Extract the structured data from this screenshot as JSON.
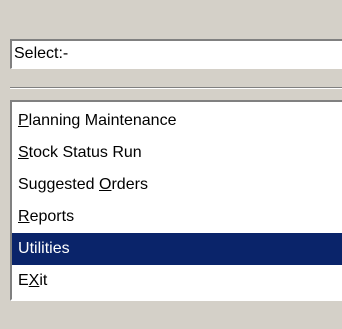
{
  "select": {
    "value": "Select:-"
  },
  "menu": {
    "selected_index": 4,
    "items": [
      {
        "label": "Planning Maintenance",
        "mnemonic_index": 0
      },
      {
        "label": "Stock Status Run",
        "mnemonic_index": 0
      },
      {
        "label": "Suggested Orders",
        "mnemonic_index": 10
      },
      {
        "label": "Reports",
        "mnemonic_index": 0
      },
      {
        "label": "Utilities",
        "mnemonic_index": -1
      },
      {
        "label": "EXit",
        "mnemonic_index": 1
      }
    ]
  },
  "colors": {
    "selection_background": "#0a246a",
    "selection_text": "#ffffff",
    "window_background": "#d4d0c8"
  }
}
